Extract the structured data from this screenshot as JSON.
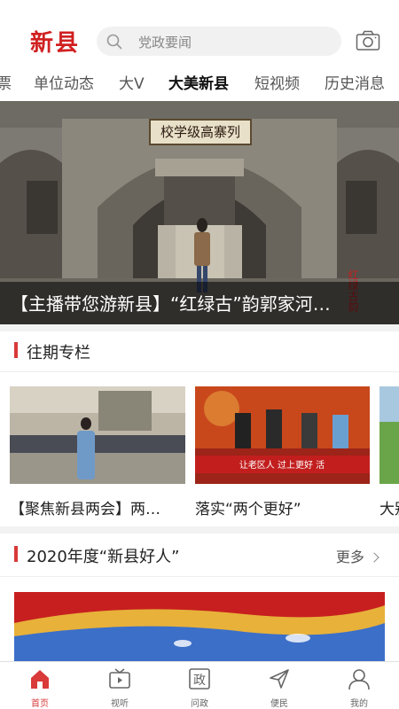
{
  "header": {
    "logo_text": "新县",
    "search_placeholder": "党政要闻",
    "brand_color": "#d02020"
  },
  "tabs": [
    {
      "label": "票"
    },
    {
      "label": "单位动态"
    },
    {
      "label": "大V"
    },
    {
      "label": "大美新县",
      "active": true
    },
    {
      "label": "短视频"
    },
    {
      "label": "历史消息"
    }
  ],
  "hero": {
    "plaque_text": "校学级高寨列",
    "caption": "【主播带您游新县】“红绿古”韵郭家河…"
  },
  "past_columns": {
    "title": "往期专栏",
    "cards": [
      {
        "text": "【聚焦新县两会】两…"
      },
      {
        "text": "落实“两个更好”",
        "banner": "让老区人  过上更好  活"
      },
      {
        "text": "大别"
      }
    ]
  },
  "good_people": {
    "title": "2020年度“新县好人”",
    "more_label": "更多"
  },
  "bottom_nav": [
    {
      "label": "首页",
      "icon": "home-icon",
      "active": true
    },
    {
      "label": "视听",
      "icon": "tv-icon"
    },
    {
      "label": "问政",
      "icon": "politics-icon"
    },
    {
      "label": "便民",
      "icon": "send-icon"
    },
    {
      "label": "我的",
      "icon": "user-icon"
    }
  ],
  "accent_color": "#d93a3a"
}
